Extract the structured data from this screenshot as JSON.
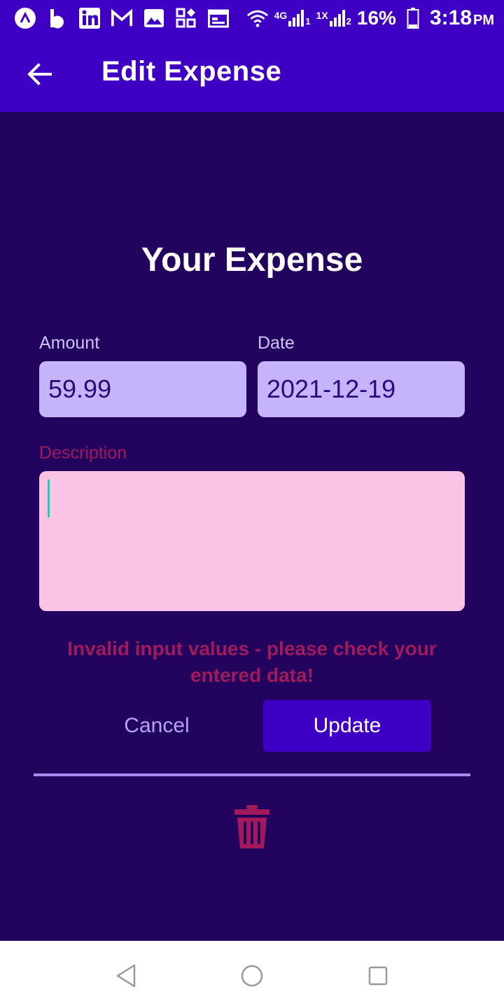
{
  "status_bar": {
    "icons": [
      "app-a-icon",
      "app-b-icon",
      "linkedin-icon",
      "gmail-icon",
      "gallery-icon",
      "apps-icon",
      "calendar-icon"
    ],
    "network_4g": "4G",
    "network_1x": "1X",
    "sim1": "1",
    "sim2": "2",
    "battery": "16%",
    "time": "3:18",
    "ampm": "PM"
  },
  "app_bar": {
    "title": "Edit Expense",
    "back_icon": "arrow-back-icon"
  },
  "form": {
    "heading": "Your Expense",
    "amount_label": "Amount",
    "amount_value": "59.99",
    "date_label": "Date",
    "date_value": "2021-12-19",
    "description_label": "Description",
    "description_value": "",
    "error_message": "Invalid input values - please check your entered data!",
    "cancel_label": "Cancel",
    "update_label": "Update",
    "delete_icon": "trash-icon"
  },
  "colors": {
    "app_bar": "#3f00c4",
    "background": "#22045f",
    "input_bg": "#c6b4fb",
    "invalid_input_bg": "#f9c3e4",
    "error": "#a01a5c",
    "accent": "#a98af0"
  },
  "nav_bar": {
    "icons": [
      "back-triangle-icon",
      "home-circle-icon",
      "recents-square-icon"
    ]
  }
}
